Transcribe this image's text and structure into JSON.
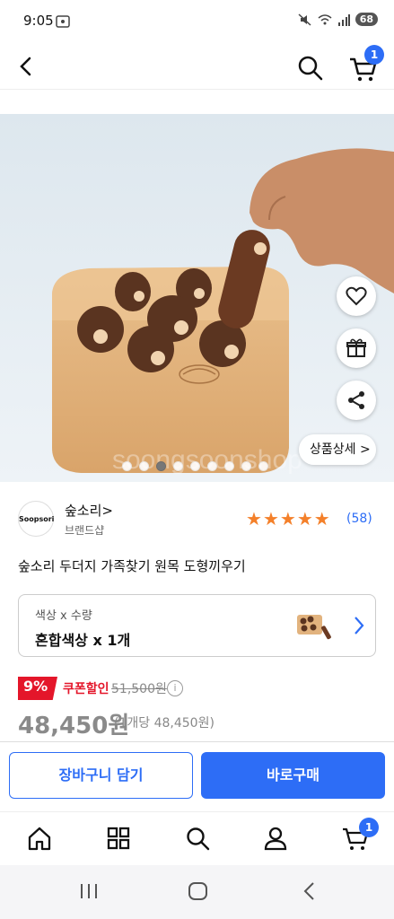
{
  "status": {
    "time": "9:05",
    "battery": "68"
  },
  "topnav": {
    "cart_count": "1"
  },
  "hero": {
    "watermark": "soongsoonshop",
    "slide_count": 9,
    "active_slide": 2,
    "detail_label": "상품상세 >"
  },
  "brand": {
    "logo_text": "Soopsori",
    "name": "숲소리>",
    "sub": "브랜드샵",
    "rating": 5,
    "review_count": "(58)"
  },
  "product": {
    "title": "숲소리 두더지 가족찾기 원목 도형끼우기"
  },
  "option": {
    "label": "색상 x 수량",
    "value": "혼합색상 x 1개"
  },
  "price": {
    "discount": "9%",
    "coupon": "쿠폰할인",
    "original": "51,500원",
    "info": "i",
    "current": "48,450원",
    "unit": "(1개당 48,450원)"
  },
  "actions": {
    "cart": "장바구니 담기",
    "buy": "바로구매"
  },
  "bottomnav": {
    "cart_count": "1",
    "items": [
      "home-icon",
      "category-icon",
      "search-icon",
      "user-icon",
      "cart-icon"
    ]
  },
  "colors": {
    "accent": "#2d6df6",
    "discount": "#e4162a",
    "star": "#f4802a"
  }
}
